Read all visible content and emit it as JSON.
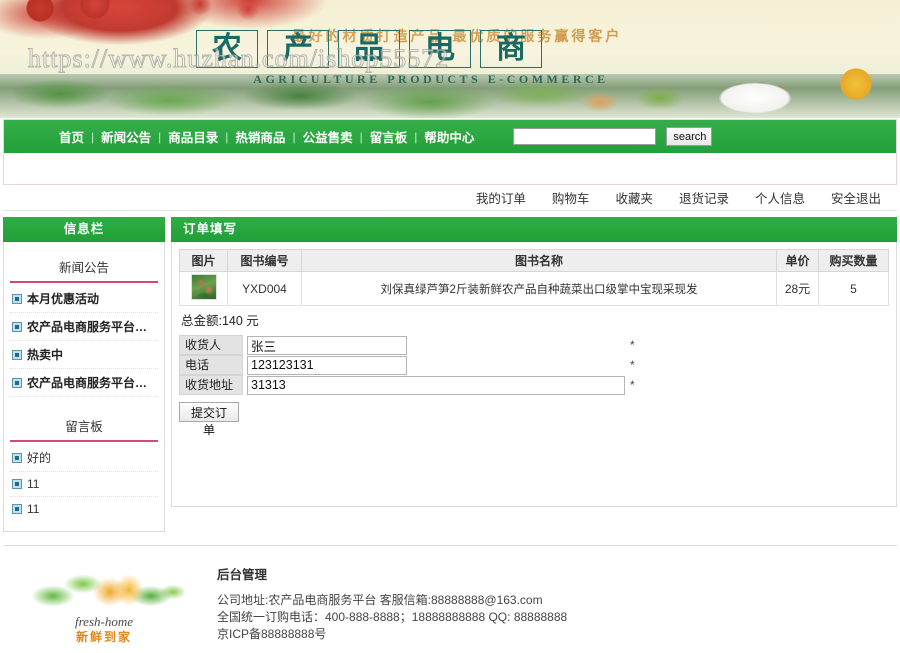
{
  "banner": {
    "slogan": "最好的材质打造产品  最优质的服务赢得客户",
    "title_chars": [
      "农",
      "产",
      "品",
      "电",
      "商"
    ],
    "subtitle": "AGRICULTURE PRODUCTS E-COMMERCE",
    "watermark": "https://www.huzhan.com/ishop55572"
  },
  "nav": {
    "items": [
      {
        "label": "首页"
      },
      {
        "label": "新闻公告"
      },
      {
        "label": "商品目录"
      },
      {
        "label": "热销商品"
      },
      {
        "label": "公益售卖"
      },
      {
        "label": "留言板"
      },
      {
        "label": "帮助中心"
      }
    ],
    "separator": "|",
    "search": {
      "value": "",
      "placeholder": "",
      "button_label": "search"
    }
  },
  "userbar": {
    "links": [
      {
        "label": "我的订单"
      },
      {
        "label": "购物车"
      },
      {
        "label": "收藏夹"
      },
      {
        "label": "退货记录"
      },
      {
        "label": "个人信息"
      },
      {
        "label": "安全退出"
      }
    ]
  },
  "sidebar": {
    "header": "信息栏",
    "sections": [
      {
        "title": "新闻公告",
        "items": [
          {
            "label": "本月优惠活动",
            "bold": true
          },
          {
            "label": "农产品电商服务平台欢...",
            "bold": true
          },
          {
            "label": "热卖中",
            "bold": true
          },
          {
            "label": "农产品电商服务平台正...",
            "bold": true
          }
        ]
      },
      {
        "title": "留言板",
        "items": [
          {
            "label": "好的",
            "bold": false
          },
          {
            "label": "11",
            "bold": false
          },
          {
            "label": "11",
            "bold": false
          }
        ]
      }
    ]
  },
  "content": {
    "header": "订单填写",
    "table": {
      "columns": [
        "图片",
        "图书编号",
        "图书名称",
        "单价",
        "购买数量"
      ],
      "rows": [
        {
          "image": "product-thumbnail",
          "code": "YXD004",
          "name": "刘保真绿芦笋2斤装新鲜农产品自种蔬菜出口级掌中宝现采现发",
          "price": "28元",
          "quantity": "5"
        }
      ]
    },
    "total_label": "总金额:140 元",
    "form": {
      "fields": [
        {
          "label": "收货人",
          "value": "张三",
          "required_mark": "*",
          "size": "narrow"
        },
        {
          "label": "电话",
          "value": "123123131",
          "required_mark": "*",
          "size": "narrow"
        },
        {
          "label": "收货地址",
          "value": "31313",
          "required_mark": "*",
          "size": "wide"
        }
      ],
      "submit_label": "提交订单"
    }
  },
  "footer": {
    "logo": {
      "english": "fresh-home",
      "chinese": "新鲜到家"
    },
    "admin_label": "后台管理",
    "lines": [
      "公司地址:农产品电商服务平台    客服信箱:88888888@163.com",
      "全国统一订购电话：400-888-8888；18888888888  QQ: 88888888",
      "京ICP备88888888号"
    ]
  },
  "colors": {
    "brand_green": "#23a03a",
    "accent_pink": "#d24a73",
    "header_gray": "#eeeeee"
  }
}
